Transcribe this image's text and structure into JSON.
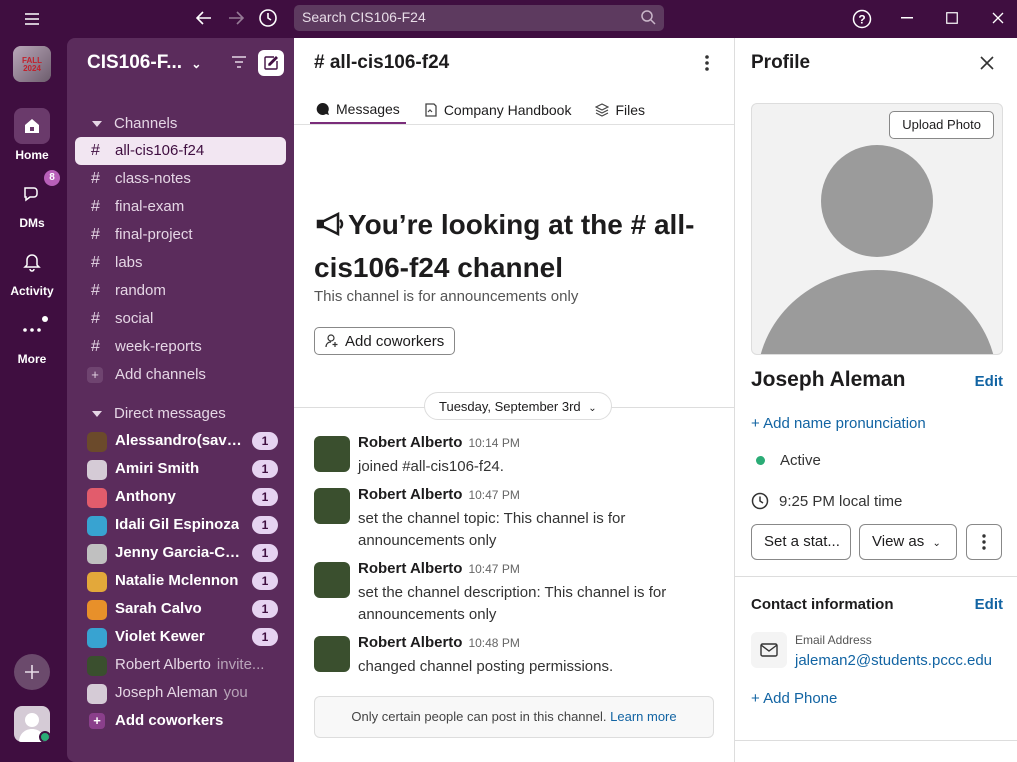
{
  "topbar": {
    "search_placeholder": "Search CIS106-F24"
  },
  "workspace": {
    "name": "CIS106-F...",
    "logo_text": "FALL 2024"
  },
  "rail": {
    "home": "Home",
    "dms": "DMs",
    "dms_badge": "8",
    "activity": "Activity",
    "more": "More"
  },
  "sidebar": {
    "channels_header": "Channels",
    "channels": [
      {
        "name": "all-cis106-f24"
      },
      {
        "name": "class-notes"
      },
      {
        "name": "final-exam"
      },
      {
        "name": "final-project"
      },
      {
        "name": "labs"
      },
      {
        "name": "random"
      },
      {
        "name": "social"
      },
      {
        "name": "week-reports"
      }
    ],
    "add_channels": "Add channels",
    "dm_header": "Direct messages",
    "dms": [
      {
        "name": "Alessandro(savill...",
        "badge": "1",
        "avatar_color": "#6b4a2b"
      },
      {
        "name": "Amiri Smith",
        "badge": "1",
        "avatar_color": "#d5cbd6"
      },
      {
        "name": "Anthony",
        "badge": "1",
        "avatar_color": "#e25c6c"
      },
      {
        "name": "Idali Gil Espinoza",
        "badge": "1",
        "avatar_color": "#38a3d1"
      },
      {
        "name": "Jenny Garcia-Cua...",
        "badge": "1",
        "avatar_color": "#c0c0c0"
      },
      {
        "name": "Natalie Mclennon",
        "badge": "1",
        "avatar_color": "#e3a83a"
      },
      {
        "name": "Sarah Calvo",
        "badge": "1",
        "avatar_color": "#e8902a"
      },
      {
        "name": "Violet Kewer",
        "badge": "1",
        "avatar_color": "#38a3d1"
      },
      {
        "name": "Robert Alberto",
        "suffix": "invite...",
        "avatar_color": "#3a4f2e"
      },
      {
        "name": "Joseph Aleman",
        "suffix": "you",
        "avatar_color": "#d5cbd6"
      }
    ],
    "add_coworkers": "Add coworkers"
  },
  "channel": {
    "title": "# all-cis106-f24",
    "tabs": [
      "Messages",
      "Company Handbook",
      "Files"
    ],
    "intro_title": "You’re looking at the # all-cis106-f24 channel",
    "intro_sub": "This channel is for announcements only",
    "add_coworkers": "Add coworkers",
    "date_pill": "Tuesday, September 3rd",
    "messages": [
      {
        "author": "Robert Alberto",
        "time": "10:14 PM",
        "text": "joined #all-cis106-f24."
      },
      {
        "author": "Robert Alberto",
        "time": "10:47 PM",
        "text": "set the channel topic: This channel is for announcements only"
      },
      {
        "author": "Robert Alberto",
        "time": "10:47 PM",
        "text": "set the channel description: This channel is for announcements only"
      },
      {
        "author": "Robert Alberto",
        "time": "10:48 PM",
        "text": "changed channel posting permissions."
      }
    ],
    "notice": "Only certain people can post in this channel.",
    "learn_more": "Learn more"
  },
  "profile": {
    "title": "Profile",
    "upload_photo": "Upload Photo",
    "name": "Joseph Aleman",
    "edit": "Edit",
    "add_pronunciation": "Add name pronunciation",
    "status": "Active",
    "local_time": "9:25 PM local time",
    "set_status": "Set a stat...",
    "view_as": "View as",
    "contact_title": "Contact information",
    "contact_edit": "Edit",
    "email_label": "Email Address",
    "email": "jaleman2@students.pccc.edu",
    "add_phone": "Add Phone"
  },
  "colors": {
    "aubergine": "#3f0e40",
    "sidebar": "#5b2c5c",
    "link": "#1264a3",
    "active_green": "#2bac76"
  }
}
